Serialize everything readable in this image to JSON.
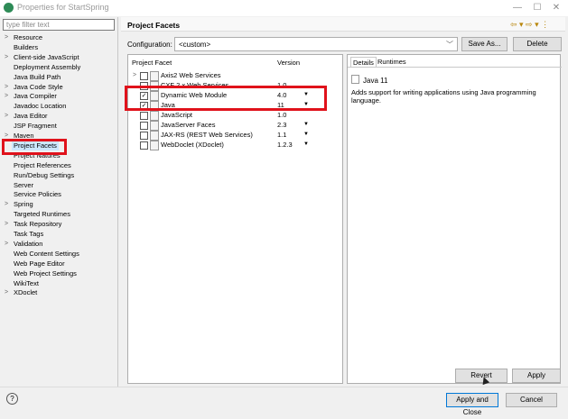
{
  "window": {
    "title": "Properties for StartSpring",
    "minimize": "—",
    "maximize": "☐",
    "close": "✕"
  },
  "sidebar": {
    "filter_placeholder": "type filter text",
    "items": [
      {
        "label": "Resource",
        "arrow": ">"
      },
      {
        "label": "Builders",
        "arrow": ""
      },
      {
        "label": "Client-side JavaScript",
        "arrow": ">"
      },
      {
        "label": "Deployment Assembly",
        "arrow": ""
      },
      {
        "label": "Java Build Path",
        "arrow": ""
      },
      {
        "label": "Java Code Style",
        "arrow": ">"
      },
      {
        "label": "Java Compiler",
        "arrow": ">"
      },
      {
        "label": "Javadoc Location",
        "arrow": ""
      },
      {
        "label": "Java Editor",
        "arrow": ">"
      },
      {
        "label": "JSP Fragment",
        "arrow": ""
      },
      {
        "label": "Maven",
        "arrow": ">"
      },
      {
        "label": "Project Facets",
        "arrow": "",
        "selected": true
      },
      {
        "label": "Project Natures",
        "arrow": ""
      },
      {
        "label": "Project References",
        "arrow": ""
      },
      {
        "label": "Run/Debug Settings",
        "arrow": ""
      },
      {
        "label": "Server",
        "arrow": ""
      },
      {
        "label": "Service Policies",
        "arrow": ""
      },
      {
        "label": "Spring",
        "arrow": ">"
      },
      {
        "label": "Targeted Runtimes",
        "arrow": ""
      },
      {
        "label": "Task Repository",
        "arrow": ">"
      },
      {
        "label": "Task Tags",
        "arrow": ""
      },
      {
        "label": "Validation",
        "arrow": ">"
      },
      {
        "label": "Web Content Settings",
        "arrow": ""
      },
      {
        "label": "Web Page Editor",
        "arrow": ""
      },
      {
        "label": "Web Project Settings",
        "arrow": ""
      },
      {
        "label": "WikiText",
        "arrow": ""
      },
      {
        "label": "XDoclet",
        "arrow": ">"
      }
    ]
  },
  "panel": {
    "title": "Project Facets",
    "nav": "⇦ ▾ ⇨ ▾ ⋮",
    "configuration_label": "Configuration:",
    "configuration_value": "<custom>",
    "save_as_label": "Save As...",
    "delete_label": "Delete"
  },
  "facets": {
    "col_facet": "Project Facet",
    "col_version": "Version",
    "rows": [
      {
        "name": "Axis2 Web Services",
        "version": "",
        "checked": false,
        "expander": ">",
        "caret": ""
      },
      {
        "name": "CXF 2.x Web Services",
        "version": "1.0",
        "checked": false,
        "expander": "",
        "caret": ""
      },
      {
        "name": "Dynamic Web Module",
        "version": "4.0",
        "checked": true,
        "expander": "",
        "caret": "▼"
      },
      {
        "name": "Java",
        "version": "11",
        "checked": true,
        "expander": "",
        "caret": "▼"
      },
      {
        "name": "JavaScript",
        "version": "1.0",
        "checked": false,
        "expander": "",
        "caret": ""
      },
      {
        "name": "JavaServer Faces",
        "version": "2.3",
        "checked": false,
        "expander": "",
        "caret": "▼"
      },
      {
        "name": "JAX-RS (REST Web Services)",
        "version": "1.1",
        "checked": false,
        "expander": "",
        "caret": "▼"
      },
      {
        "name": "WebDoclet (XDoclet)",
        "version": "1.2.3",
        "checked": false,
        "expander": "",
        "caret": "▼"
      }
    ]
  },
  "details": {
    "tab_details": "Details",
    "tab_runtimes": "Runtimes",
    "title": "Java 11",
    "description": "Adds support for writing applications using Java programming language."
  },
  "buttons": {
    "revert": "Revert",
    "apply": "Apply",
    "apply_close": "Apply and Close",
    "cancel": "Cancel",
    "help": "?"
  }
}
